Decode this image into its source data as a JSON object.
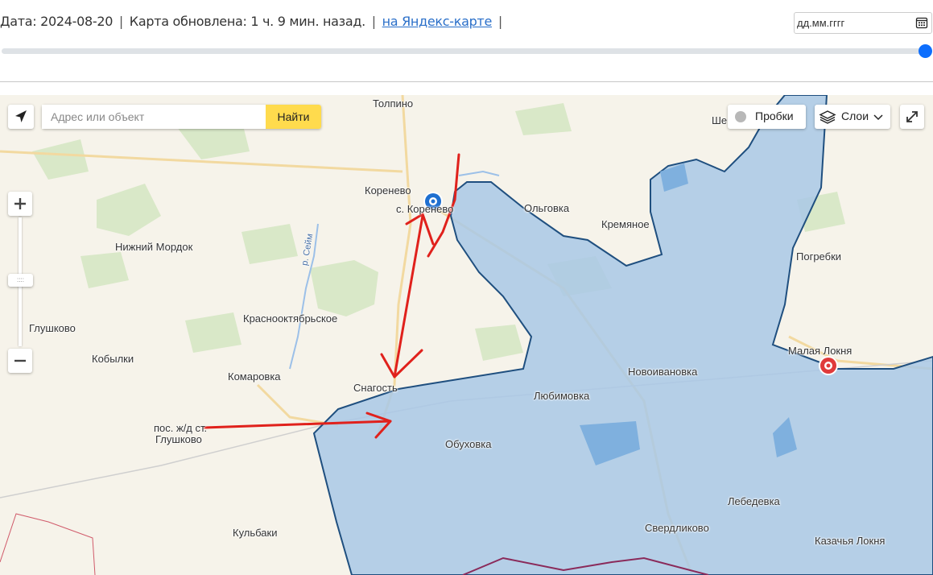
{
  "header": {
    "date_text": "Дата: 2024-08-20",
    "updated_text": "Карта обновлена: 1 ч. 9 мин. назад.",
    "yandex_link": "на Яндекс-карте",
    "separator": "|",
    "date_placeholder": "дд.мм.гггг"
  },
  "timeline": {
    "position_fraction": 1.0
  },
  "map_controls": {
    "search_placeholder": "Адрес или объект",
    "search_button": "Найти",
    "traffic_label": "Пробки",
    "layers_label": "Слои",
    "zoom_handle_glyph": "::::",
    "zoom_plus": "+",
    "zoom_minus": "−"
  },
  "places": {
    "tolpino": "Толпино",
    "korenevo": "Коренево",
    "s_korenevo": "с. Коренево",
    "olgovka": "Ольговка",
    "kremyanoe": "Кремяное",
    "nizhniy_mordok": "Нижний Мордок",
    "pogrebki": "Погребки",
    "glushkovo": "Глушково",
    "krasnooktyabrskoe": "Краснооктябрьское",
    "kobylki": "Кобылки",
    "malaya_loknya": "Малая Локня",
    "komarovka": "Комаровка",
    "novoivanovka": "Новоивановка",
    "snagost": "Снагость",
    "lyubimovka": "Любимовка",
    "pos_zhd_st_line1": "пос. ж/д ст.",
    "pos_zhd_st_line2": "Глушково",
    "obukhovka": "Обуховка",
    "lebedevka": "Лебедевка",
    "sverdlikovo": "Свердликово",
    "kulbaki": "Кульбаки",
    "kazachya_loknya": "Казачья Локня",
    "she": "Ше",
    "river_seym": "р. Сейм"
  },
  "colors": {
    "occupied_fill": "#a9c8e6",
    "occupied_border": "#1f4f7f",
    "arrows": "#e0211c",
    "marker_blue": "#1e6fd0",
    "marker_red": "#e03a3a",
    "search_button": "#ffdb4d"
  },
  "icons": [
    "locate-arrow-icon",
    "traffic-icon",
    "layers-icon",
    "chevron-down-icon",
    "fullscreen-icon",
    "calendar-icon",
    "zoom-in-icon",
    "zoom-out-icon"
  ]
}
